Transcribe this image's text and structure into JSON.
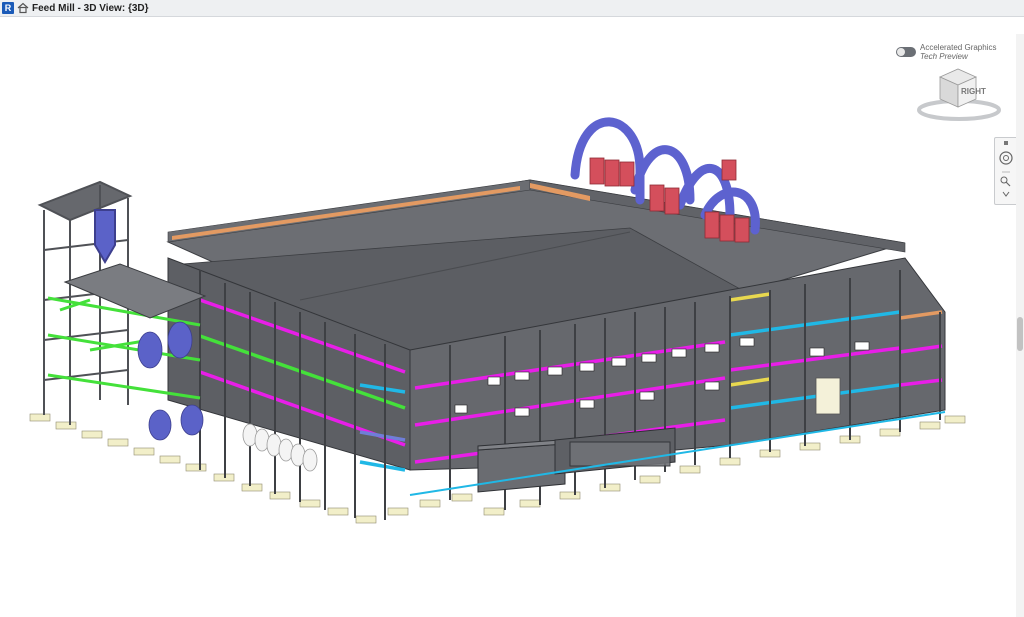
{
  "window": {
    "app_badge": "R",
    "title": "Feed Mill - 3D View: {3D}"
  },
  "overlay": {
    "accelerated_title": "Accelerated Graphics",
    "accelerated_subtitle": "Tech Preview",
    "viewcube_face": "RIGHT"
  },
  "colors": {
    "concrete": "#5f6166",
    "roof": "#696b70",
    "magenta": "#e81ee8",
    "cyan": "#20b8e6",
    "green": "#44e13a",
    "orange": "#e39a62",
    "yellow": "#e8d84f",
    "footing": "#f2efc9",
    "duct_blue": "#5d62cf",
    "cyclone_red": "#d44f5c",
    "tank_blue": "#5b62c8"
  }
}
